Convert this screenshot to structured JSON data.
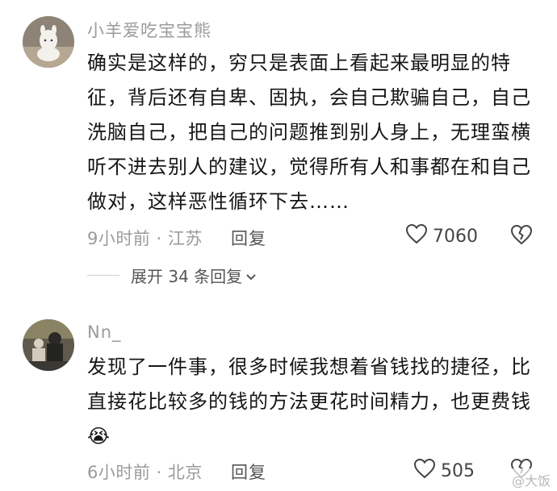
{
  "comments": [
    {
      "username": "小羊爱吃宝宝熊",
      "text": "确实是这样的，穷只是表面上看起来最明显的特征，背后还有自卑、固执，会自己欺骗自己，自己洗脑自己，把自己的问题推到别人身上，无理蛮横听不进去别人的建议，觉得所有人和事都在和自己做对，这样恶性循环下去……",
      "time_location": "9小时前 · 江苏",
      "reply_label": "回复",
      "likes": "7060",
      "expand_label": "展开 34 条回复"
    },
    {
      "username": "Nn_",
      "text": "发现了一件事，很多时候我想着省钱找的捷径，比直接花比较多的钱的方法更花时间精力，也更费钱😭",
      "time_location": "6小时前 · 北京",
      "reply_label": "回复",
      "likes": "505"
    }
  ],
  "watermark": "@大饭",
  "icons": {
    "like": "heart-outline-icon",
    "dislike": "broken-heart-icon",
    "expand": "chevron-down-icon"
  },
  "colors": {
    "meta": "#9b9b9b",
    "text": "#161616"
  }
}
